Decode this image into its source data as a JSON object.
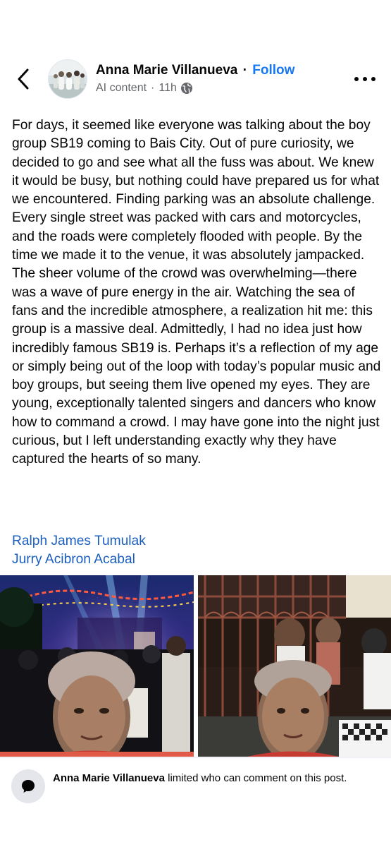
{
  "header": {
    "author_name": "Anna Marie Villanueva",
    "separator": "·",
    "follow_label": "Follow",
    "content_label": "AI content",
    "meta_separator": "·",
    "time_ago": "11h",
    "privacy_icon": "globe-icon",
    "back_icon": "chevron-left-icon",
    "more_icon": "more-horizontal-icon"
  },
  "post": {
    "text": "For days, it seemed like everyone was talking about the boy group SB19 coming to Bais City. Out of pure curiosity, we decided to go and see what all the fuss was about. We knew it would be busy, but nothing could have prepared us for what we encountered. Finding parking was an absolute challenge. Every single street was packed with cars and motorcycles, and the roads were completely flooded with people. By the time we made it to the venue, it was absolutely jampacked. The sheer volume of the crowd was overwhelming—there was a wave of pure energy in the air. Watching the sea of fans and the incredible atmosphere, a realization hit me: this group is a massive deal. Admittedly, I had no idea just how incredibly famous SB19 is. Perhaps it’s a reflection of my age or simply being out of the loop with today’s popular music and boy groups, but seeing them live opened my eyes. They are young, exceptionally talented singers and dancers who know how to command a crowd. I may have gone into the night just curious, but I left understanding exactly why they have captured the hearts of so many.",
    "tagged": [
      "Ralph James Tumulak",
      "Jurry Acibron Acabal"
    ]
  },
  "notice": {
    "name": "Anna Marie Villanueva",
    "text": " limited who can comment on this post.",
    "icon": "comment-bubble-icon"
  },
  "colors": {
    "link": "#1877f2",
    "tag_link": "#1b5fbe",
    "meta_gray": "#65676b"
  }
}
